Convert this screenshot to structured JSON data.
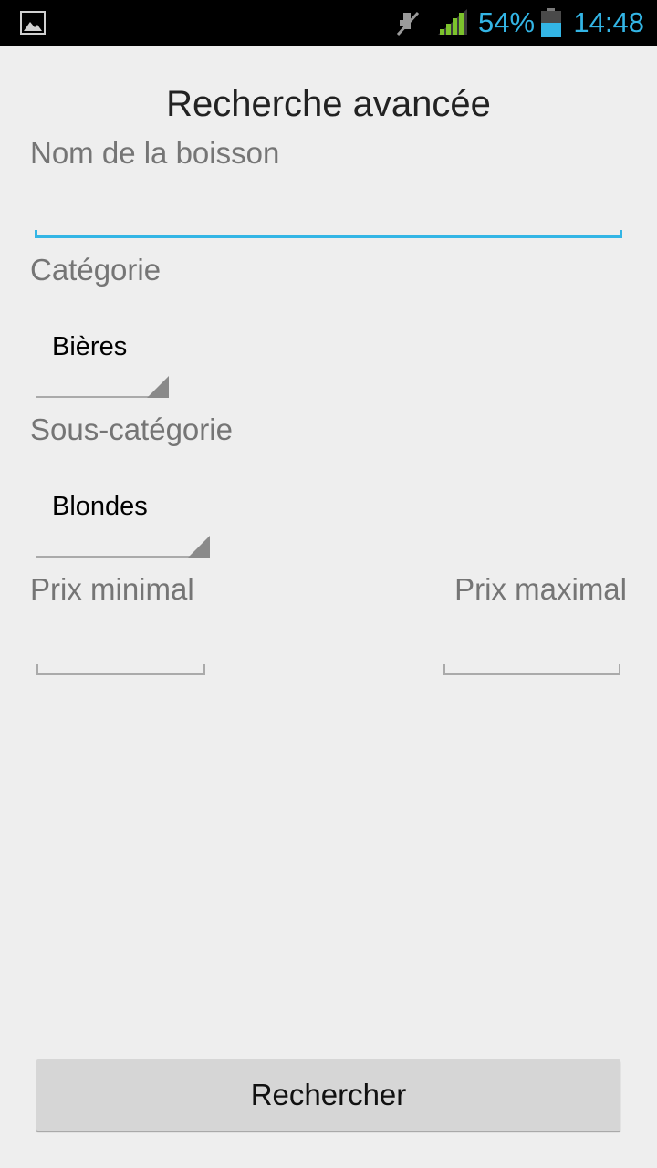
{
  "status_bar": {
    "icons": [
      "image-notification-icon",
      "mute-icon",
      "signal-icon",
      "battery-icon"
    ],
    "battery_percent": "54%",
    "time": "14:48",
    "accent_color": "#33b5e5"
  },
  "screen": {
    "title": "Recherche avancée"
  },
  "form": {
    "drink_name": {
      "label": "Nom de la boisson",
      "value": ""
    },
    "category": {
      "label": "Catégorie",
      "selected": "Bières"
    },
    "subcategory": {
      "label": "Sous-catégorie",
      "selected": "Blondes"
    },
    "min_price": {
      "label": "Prix minimal",
      "value": ""
    },
    "max_price": {
      "label": "Prix maximal",
      "value": ""
    },
    "search_button": "Rechercher"
  }
}
